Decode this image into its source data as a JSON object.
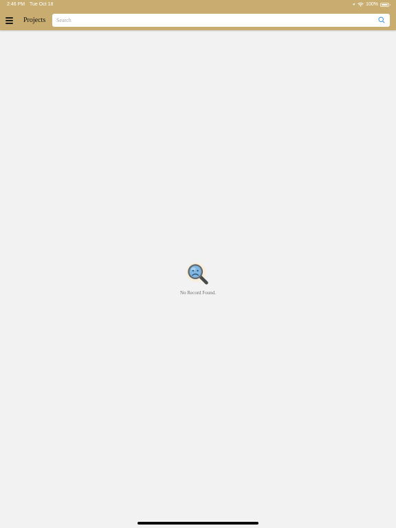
{
  "status_bar": {
    "time": "2:46 PM",
    "date": "Tue Oct 18",
    "battery_percent": "100%",
    "battery_level": 1.0,
    "icons": [
      "location-icon",
      "wifi-icon",
      "battery-icon"
    ]
  },
  "header": {
    "menu_icon": "hamburger-menu-icon",
    "title": "Projects",
    "search": {
      "placeholder": "Search",
      "value": "",
      "icon": "search-icon"
    }
  },
  "empty_state": {
    "icon": "sad-magnifier-icon",
    "message": "No Record Found."
  },
  "colors": {
    "header_bg": "#c9ad70",
    "page_bg": "#f2f2f2",
    "accent_blue": "#3a8fd9"
  }
}
